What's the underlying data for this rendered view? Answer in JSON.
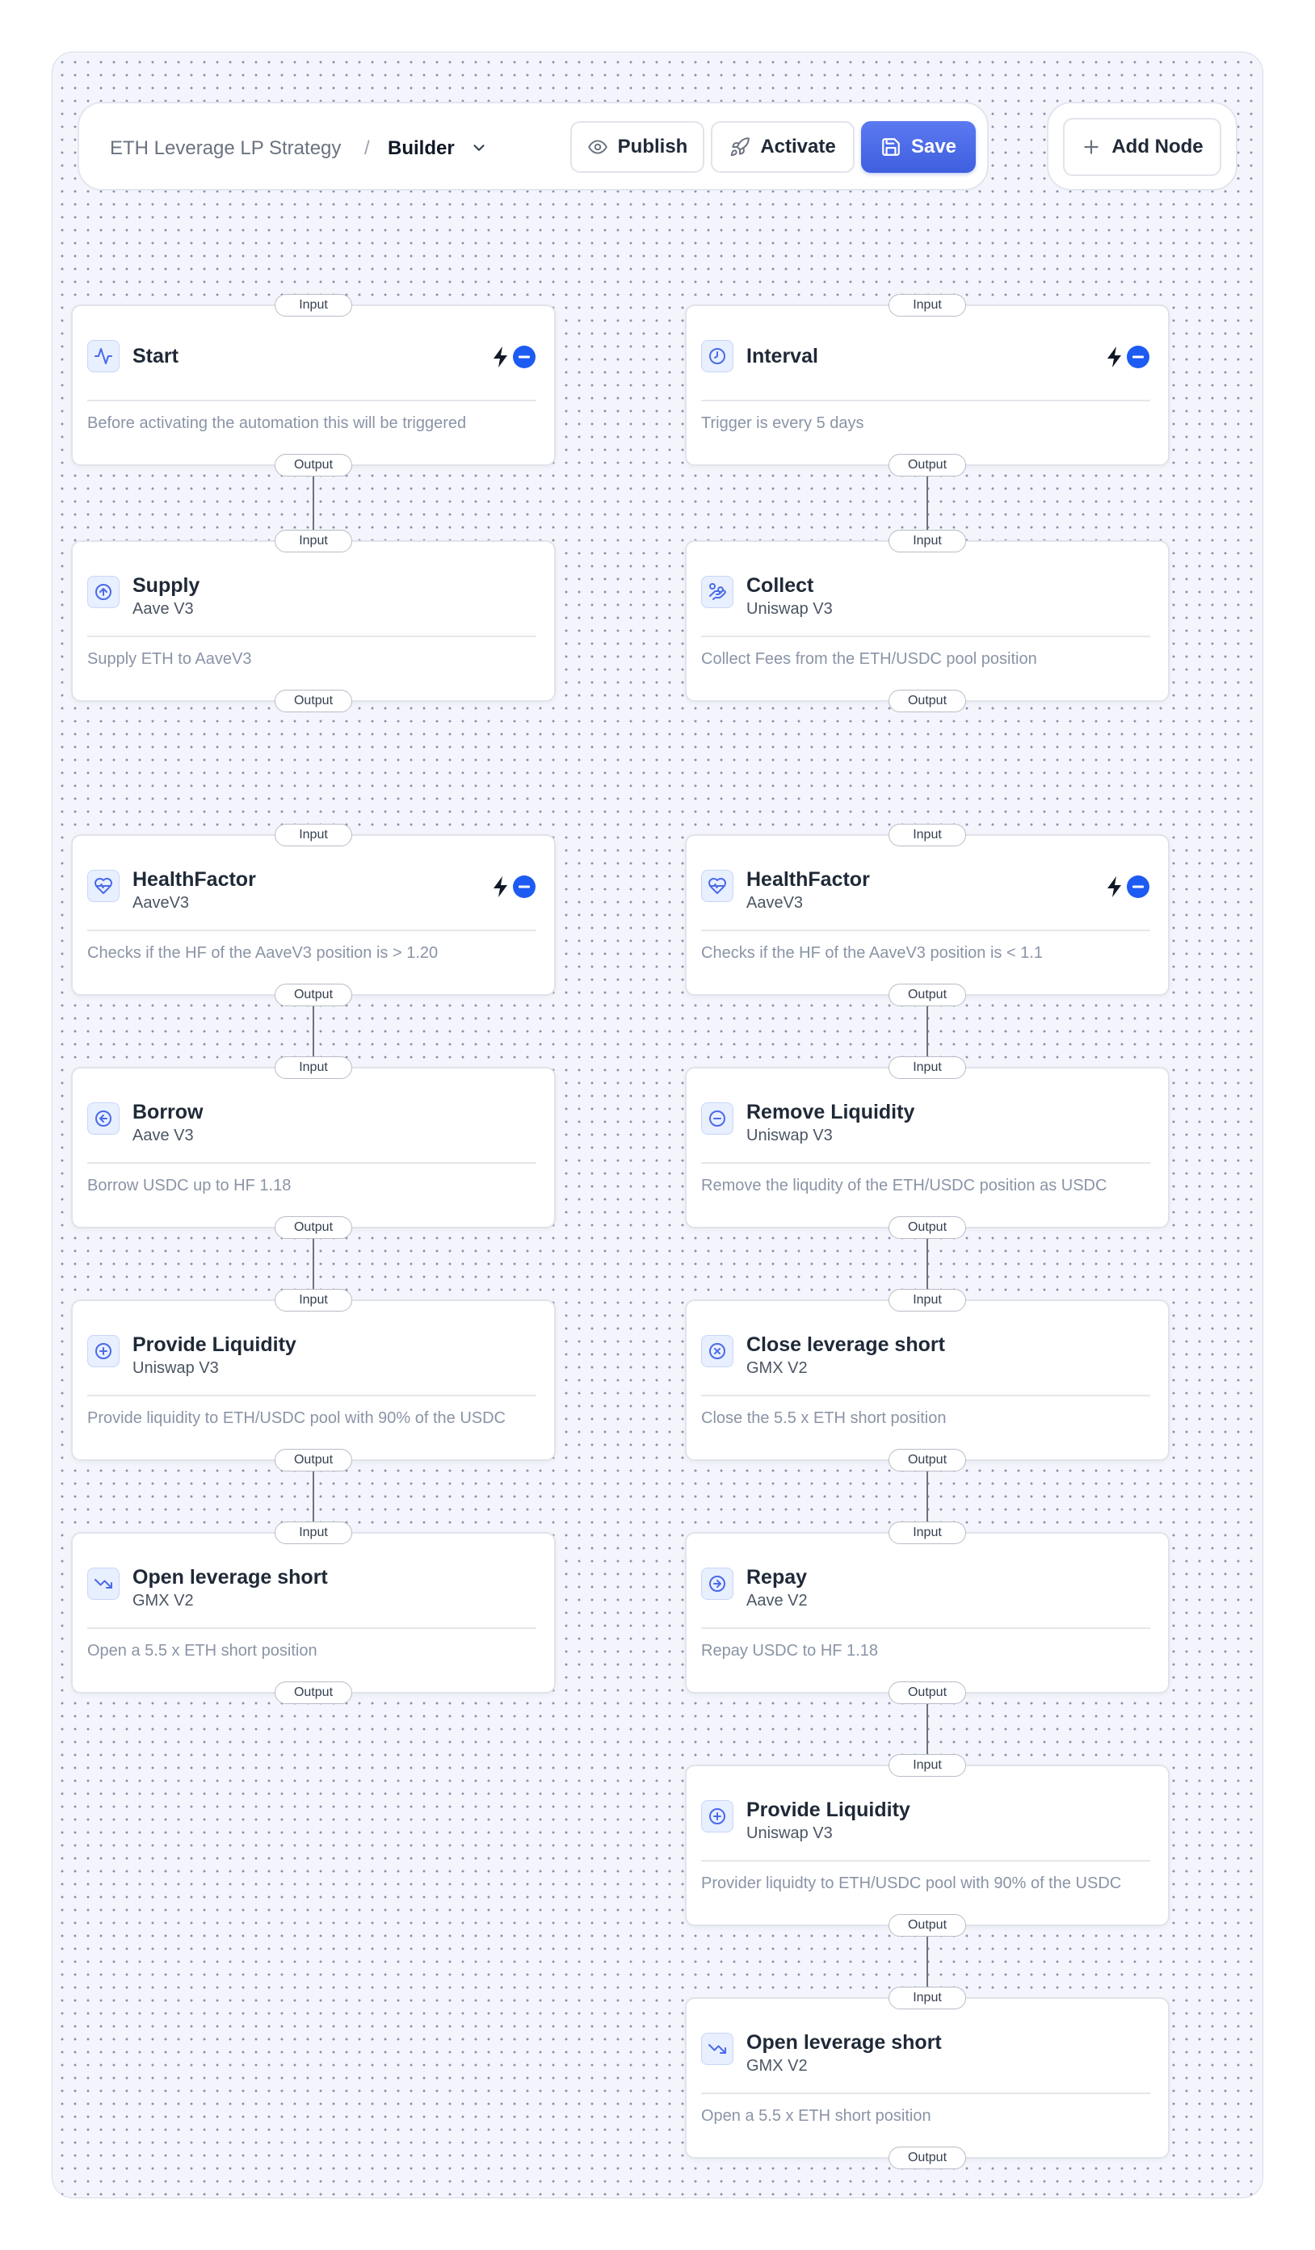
{
  "header": {
    "project": "ETH Leverage LP Strategy",
    "separator": "/",
    "current": "Builder",
    "publish_label": "Publish",
    "activate_label": "Activate",
    "save_label": "Save",
    "add_node_label": "Add Node"
  },
  "ports": {
    "input": "Input",
    "output": "Output"
  },
  "colors": {
    "accent": "#4a6ae8",
    "trigger": "#1d5bf2",
    "canvas": "#f4f5fc"
  },
  "left": [
    {
      "title": "Start",
      "subtitle": "",
      "description": "Before activating the automation this will be triggered",
      "icon": "activity-icon",
      "trigger": true
    },
    {
      "title": "Supply",
      "subtitle": "Aave V3",
      "description": "Supply ETH to AaveV3",
      "icon": "arrow-up-circle-icon",
      "trigger": false
    },
    {
      "title": "HealthFactor",
      "subtitle": "AaveV3",
      "description": "Checks if the HF of the AaveV3 position is > 1.20",
      "icon": "heart-pulse-icon",
      "trigger": true
    },
    {
      "title": "Borrow",
      "subtitle": "Aave V3",
      "description": "Borrow USDC up to HF 1.18",
      "icon": "arrow-left-circle-icon",
      "trigger": false
    },
    {
      "title": "Provide Liquidity",
      "subtitle": "Uniswap V3",
      "description": "Provide liquidity to ETH/USDC pool with 90% of the USDC",
      "icon": "plus-circle-icon",
      "trigger": false
    },
    {
      "title": "Open leverage short",
      "subtitle": "GMX V2",
      "description": "Open a 5.5 x ETH short position",
      "icon": "trending-down-icon",
      "trigger": false
    }
  ],
  "right": [
    {
      "title": "Interval",
      "subtitle": "",
      "description": "Trigger is every 5 days",
      "icon": "clock-icon",
      "trigger": true
    },
    {
      "title": "Collect",
      "subtitle": "Uniswap V3",
      "description": "Collect Fees from the ETH/USDC pool position",
      "icon": "hand-coins-icon",
      "trigger": false
    },
    {
      "title": "HealthFactor",
      "subtitle": "AaveV3",
      "description": "Checks if the HF of the AaveV3 position is < 1.1",
      "icon": "heart-pulse-icon",
      "trigger": true
    },
    {
      "title": "Remove Liquidity",
      "subtitle": "Uniswap V3",
      "description": "Remove the liqudity of the ETH/USDC position as USDC",
      "icon": "minus-circle-icon",
      "trigger": false
    },
    {
      "title": "Close leverage short",
      "subtitle": "GMX V2",
      "description": "Close the 5.5 x ETH short position",
      "icon": "x-circle-icon",
      "trigger": false
    },
    {
      "title": "Repay",
      "subtitle": "Aave V2",
      "description": "Repay USDC to HF 1.18",
      "icon": "arrow-right-circle-icon",
      "trigger": false
    },
    {
      "title": "Provide Liquidity",
      "subtitle": "Uniswap V3",
      "description": "Provider liquidty to ETH/USDC pool with 90% of the USDC",
      "icon": "plus-circle-icon",
      "trigger": false
    },
    {
      "title": "Open leverage short",
      "subtitle": "GMX V2",
      "description": "Open a 5.5 x ETH short position",
      "icon": "trending-down-icon",
      "trigger": false
    }
  ]
}
